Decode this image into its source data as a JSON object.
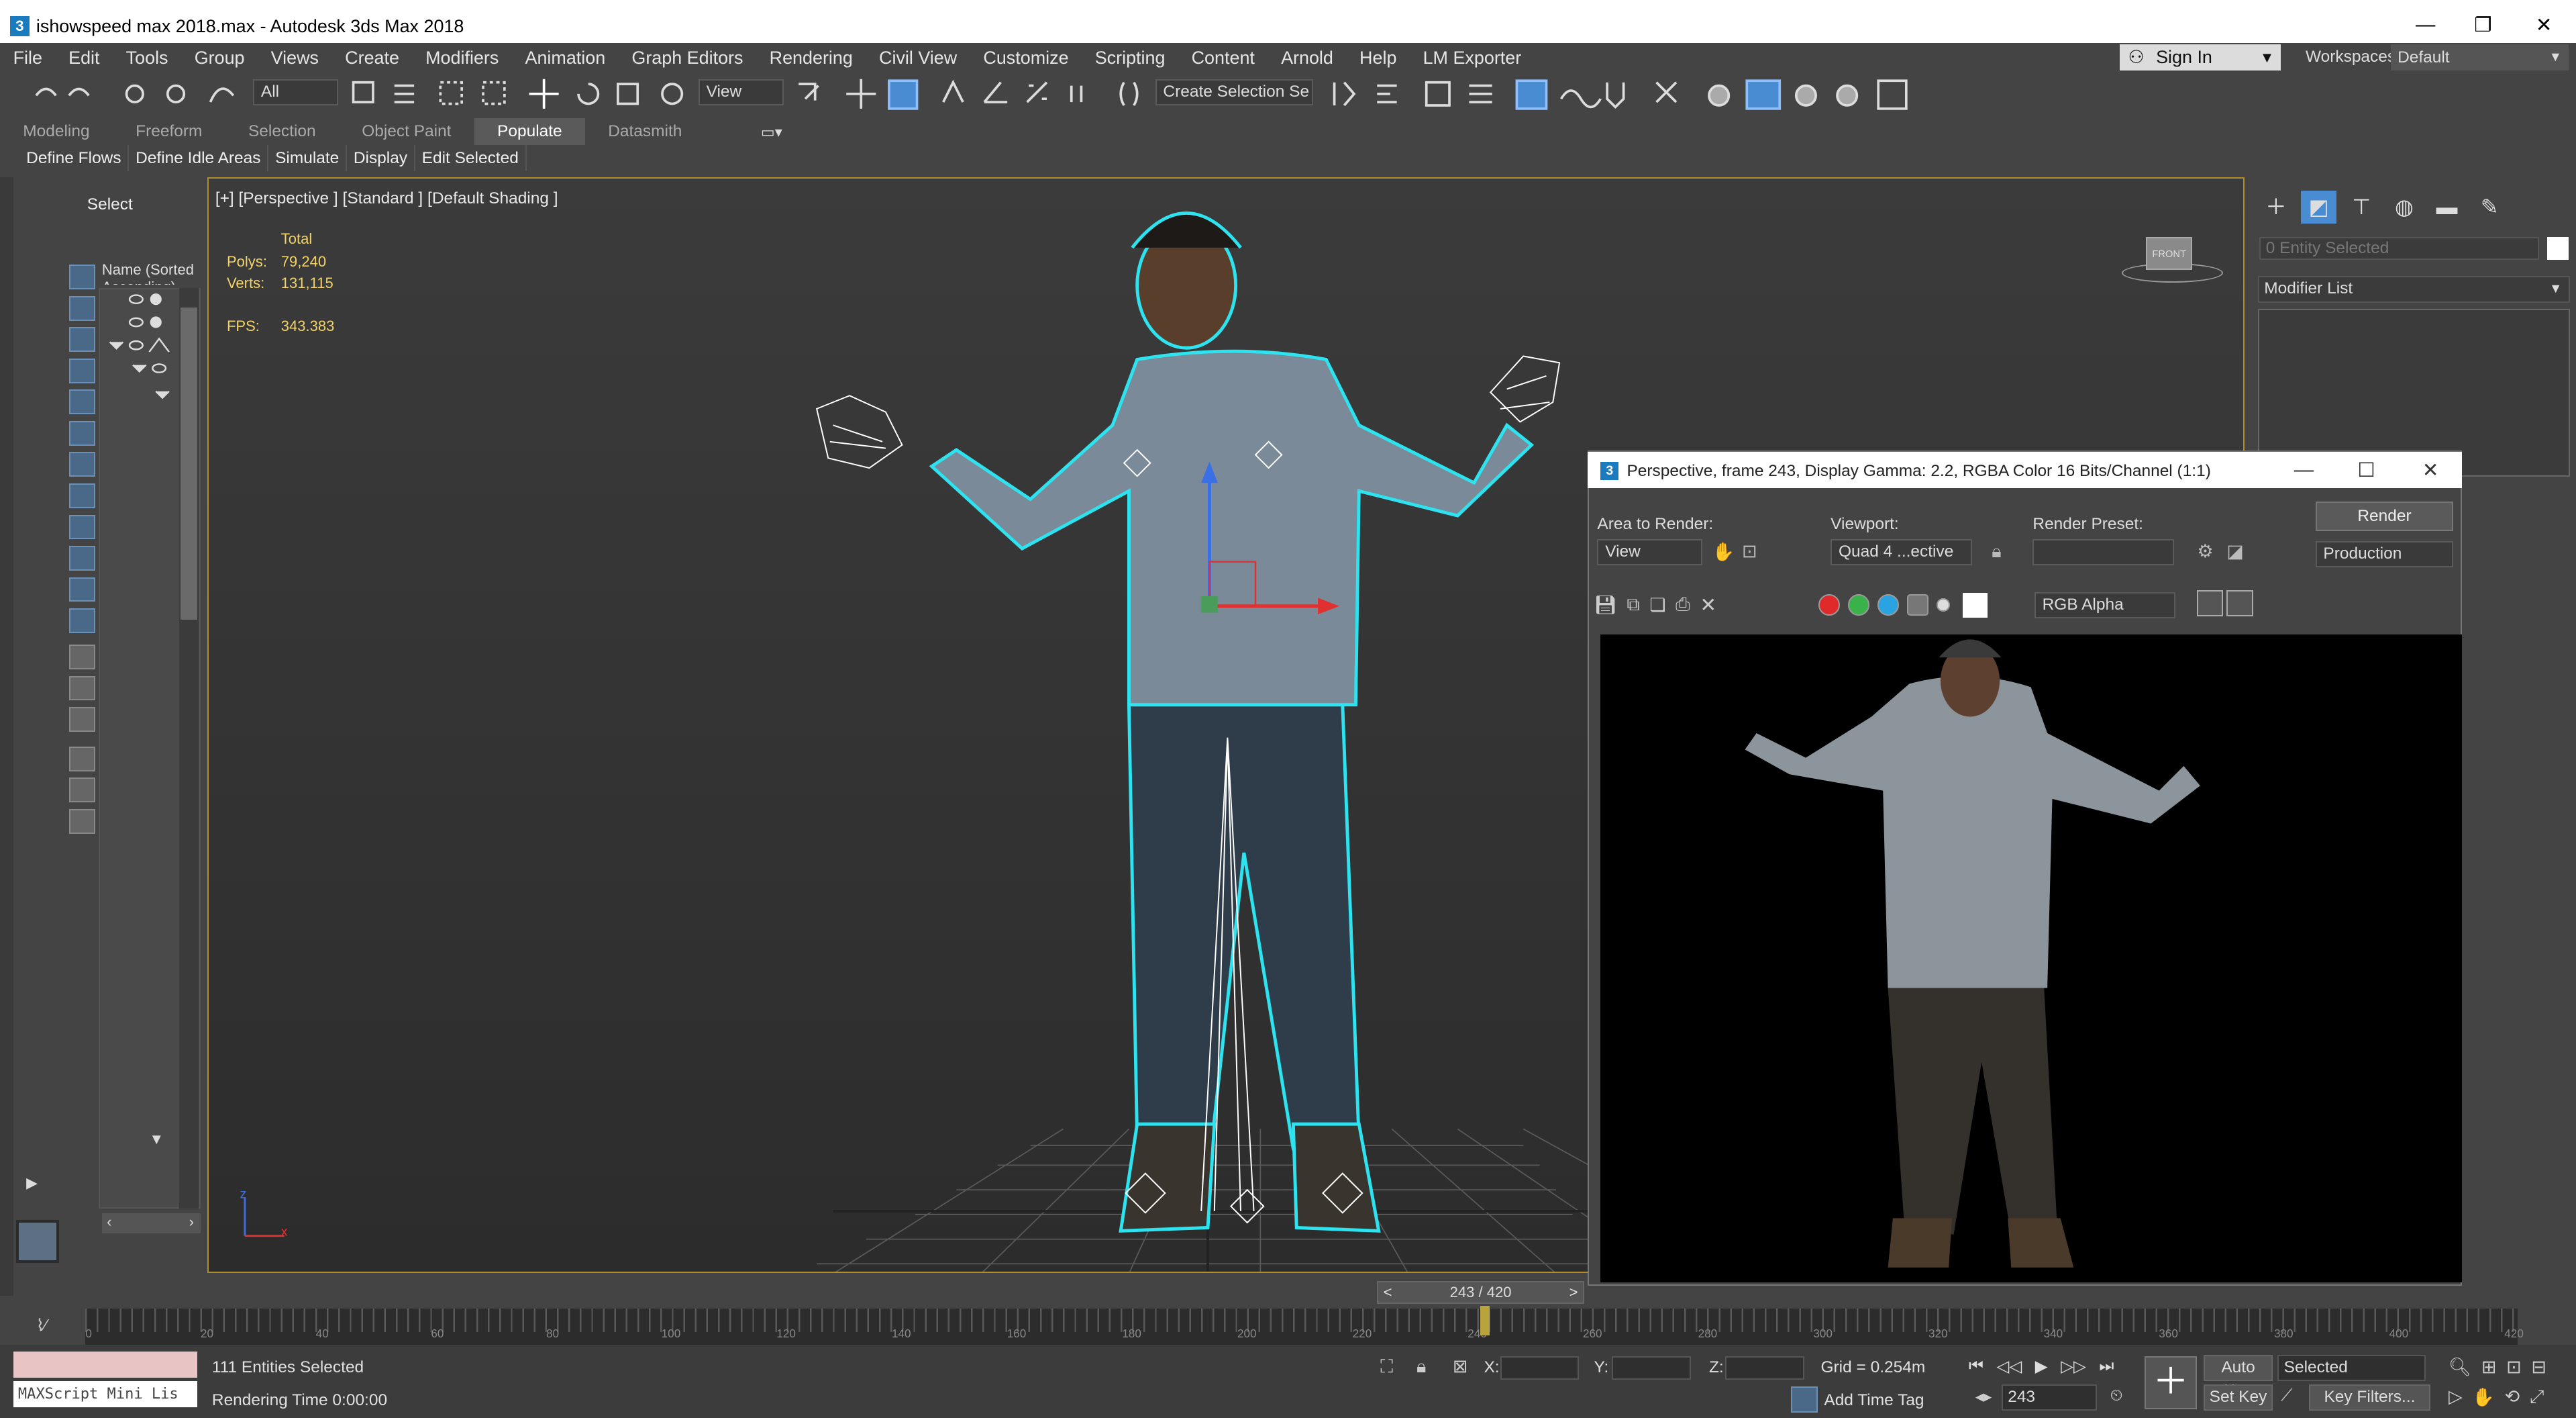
{
  "window": {
    "title": "ishowspeed max 2018.max - Autodesk 3ds Max 2018",
    "app_badge": "3",
    "minimize": "—",
    "restore": "❐",
    "close": "✕"
  },
  "menus": [
    "File",
    "Edit",
    "Tools",
    "Group",
    "Views",
    "Create",
    "Modifiers",
    "Animation",
    "Graph Editors",
    "Rendering",
    "Civil View",
    "Customize",
    "Scripting",
    "Content",
    "Arnold",
    "Help",
    "LM Exporter"
  ],
  "account": {
    "sign_in": "Sign In",
    "workspaces_label": "Workspaces:",
    "workspace": "Default"
  },
  "toolbar": {
    "selection_filter": "All",
    "ref_coord": "View",
    "named_selection": "Create Selection Se"
  },
  "ribbon": {
    "tabs": [
      "Modeling",
      "Freeform",
      "Selection",
      "Object Paint",
      "Populate",
      "Datasmith"
    ],
    "active_tab": "Populate",
    "commands": [
      "Define Flows",
      "Define Idle Areas",
      "Simulate",
      "Display",
      "Edit Selected"
    ]
  },
  "scene_explorer": {
    "mode": "Select",
    "column_header": "Name (Sorted Ascending)"
  },
  "viewport": {
    "label": "[+] [Perspective ] [Standard ] [Default Shading ]",
    "stats": {
      "total_label": "Total",
      "polys_label": "Polys:",
      "polys": "79,240",
      "verts_label": "Verts:",
      "verts": "131,115",
      "fps_label": "FPS:",
      "fps": "343.383"
    },
    "viewcube": "FRONT"
  },
  "command_panel": {
    "entity_field": "0 Entity Selected",
    "modifier_list": "Modifier List"
  },
  "render_window": {
    "title": "Perspective, frame 243, Display Gamma: 2.2, RGBA Color 16 Bits/Channel (1:1)",
    "area_to_render_label": "Area to Render:",
    "area_to_render": "View",
    "viewport_label": "Viewport:",
    "viewport": "Quad 4 ...ective",
    "render_preset_label": "Render Preset:",
    "render_preset": "",
    "render_button": "Render",
    "render_mode": "Production",
    "channel": "RGB Alpha"
  },
  "timeline": {
    "time_slider": "243 / 420",
    "current_frame": 243,
    "total_frames": 420,
    "tick_labels": [
      "0",
      "20",
      "40",
      "60",
      "80",
      "100",
      "120",
      "140",
      "160",
      "180",
      "200",
      "220",
      "240",
      "260",
      "280",
      "300",
      "320",
      "340",
      "360",
      "380",
      "400",
      "420"
    ]
  },
  "status": {
    "maxscript": "MAXScript Mini Lis",
    "selected_count": "111 Entities Selected",
    "rendering_time": "Rendering Time  0:00:00",
    "x_label": "X:",
    "y_label": "Y:",
    "z_label": "Z:",
    "grid": "Grid = 0.254m",
    "add_time_tag": "Add Time Tag",
    "frame_field": "243",
    "auto_key": "Auto Key",
    "set_key": "Set Key",
    "selected_drop": "Selected",
    "key_filters": "Key Filters..."
  },
  "colors": {
    "accent_blue": "#4a8cd1",
    "viewport_border": "#b08d2f",
    "selection_outline": "#2ee3f0",
    "stats_yellow": "#f1d36a"
  }
}
